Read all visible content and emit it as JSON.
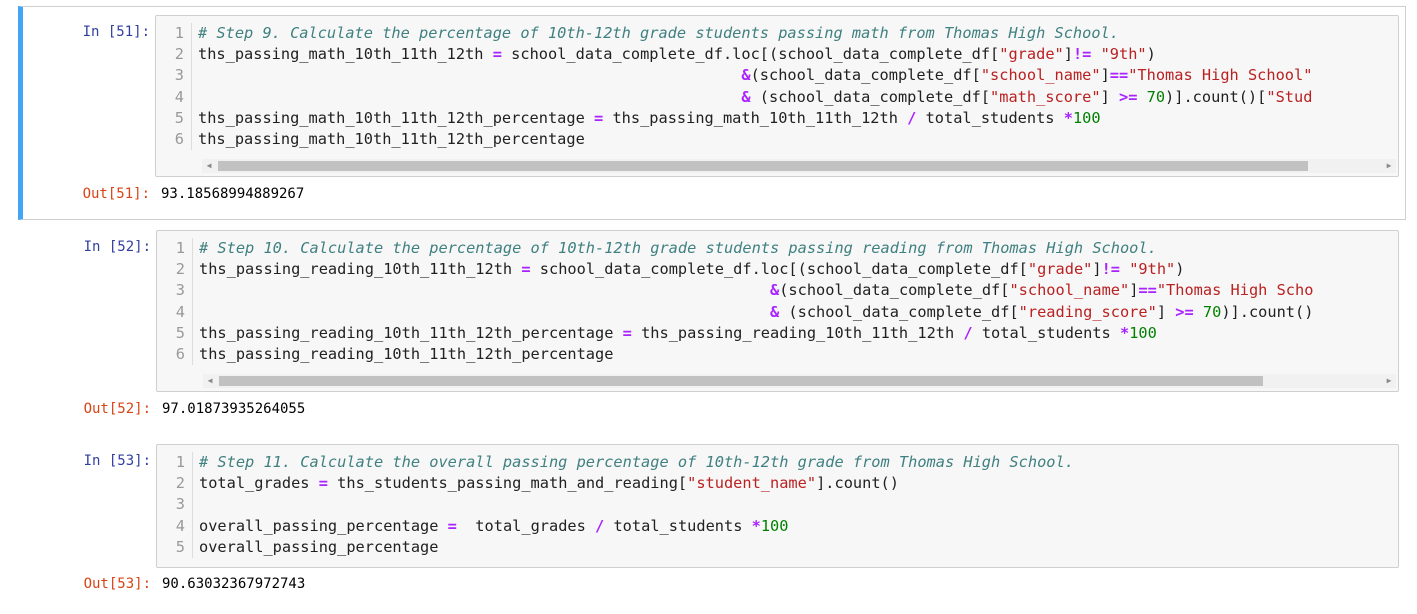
{
  "cells": [
    {
      "in_prompt": "In [51]:",
      "out_prompt": "Out[51]:",
      "output": "93.18568994889267",
      "lines": [
        {
          "n": "1",
          "tokens": [
            {
              "c": "cm-comment",
              "t": "# Step 9. Calculate the percentage of 10th-12th grade students passing math from Thomas High School."
            }
          ]
        },
        {
          "n": "2",
          "tokens": [
            {
              "c": "",
              "t": "ths_passing_math_10th_11th_12th "
            },
            {
              "c": "cm-op",
              "t": "="
            },
            {
              "c": "",
              "t": " school_data_complete_df.loc[(school_data_complete_df["
            },
            {
              "c": "cm-string",
              "t": "\"grade\""
            },
            {
              "c": "",
              "t": "]"
            },
            {
              "c": "cm-op",
              "t": "!="
            },
            {
              "c": "",
              "t": " "
            },
            {
              "c": "cm-string",
              "t": "\"9th\""
            },
            {
              "c": "",
              "t": ")"
            }
          ]
        },
        {
          "n": "3",
          "tokens": [
            {
              "c": "",
              "t": "                                                           "
            },
            {
              "c": "cm-op",
              "t": "&"
            },
            {
              "c": "",
              "t": "(school_data_complete_df["
            },
            {
              "c": "cm-string",
              "t": "\"school_name\""
            },
            {
              "c": "",
              "t": "]"
            },
            {
              "c": "cm-op",
              "t": "=="
            },
            {
              "c": "cm-string",
              "t": "\"Thomas High School\""
            }
          ]
        },
        {
          "n": "4",
          "tokens": [
            {
              "c": "",
              "t": "                                                           "
            },
            {
              "c": "cm-op",
              "t": "&"
            },
            {
              "c": "",
              "t": " (school_data_complete_df["
            },
            {
              "c": "cm-string",
              "t": "\"math_score\""
            },
            {
              "c": "",
              "t": "] "
            },
            {
              "c": "cm-op",
              "t": ">="
            },
            {
              "c": "",
              "t": " "
            },
            {
              "c": "cm-number",
              "t": "70"
            },
            {
              "c": "",
              "t": ")].count()["
            },
            {
              "c": "cm-string",
              "t": "\"Stud"
            }
          ]
        },
        {
          "n": "5",
          "tokens": [
            {
              "c": "",
              "t": "ths_passing_math_10th_11th_12th_percentage "
            },
            {
              "c": "cm-op",
              "t": "="
            },
            {
              "c": "",
              "t": " ths_passing_math_10th_11th_12th "
            },
            {
              "c": "cm-op",
              "t": "/"
            },
            {
              "c": "",
              "t": " total_students "
            },
            {
              "c": "cm-op",
              "t": "*"
            },
            {
              "c": "cm-number",
              "t": "100"
            }
          ]
        },
        {
          "n": "6",
          "tokens": [
            {
              "c": "",
              "t": "ths_passing_math_10th_11th_12th_percentage"
            }
          ]
        }
      ]
    },
    {
      "in_prompt": "In [52]:",
      "out_prompt": "Out[52]:",
      "output": "97.01873935264055",
      "lines": [
        {
          "n": "1",
          "tokens": [
            {
              "c": "cm-comment",
              "t": "# Step 10. Calculate the percentage of 10th-12th grade students passing reading from Thomas High School."
            }
          ]
        },
        {
          "n": "2",
          "tokens": [
            {
              "c": "",
              "t": "ths_passing_reading_10th_11th_12th "
            },
            {
              "c": "cm-op",
              "t": "="
            },
            {
              "c": "",
              "t": " school_data_complete_df.loc[(school_data_complete_df["
            },
            {
              "c": "cm-string",
              "t": "\"grade\""
            },
            {
              "c": "",
              "t": "]"
            },
            {
              "c": "cm-op",
              "t": "!="
            },
            {
              "c": "",
              "t": " "
            },
            {
              "c": "cm-string",
              "t": "\"9th\""
            },
            {
              "c": "",
              "t": ")"
            }
          ]
        },
        {
          "n": "3",
          "tokens": [
            {
              "c": "",
              "t": "                                                              "
            },
            {
              "c": "cm-op",
              "t": "&"
            },
            {
              "c": "",
              "t": "(school_data_complete_df["
            },
            {
              "c": "cm-string",
              "t": "\"school_name\""
            },
            {
              "c": "",
              "t": "]"
            },
            {
              "c": "cm-op",
              "t": "=="
            },
            {
              "c": "cm-string",
              "t": "\"Thomas High Scho"
            }
          ]
        },
        {
          "n": "4",
          "tokens": [
            {
              "c": "",
              "t": "                                                              "
            },
            {
              "c": "cm-op",
              "t": "&"
            },
            {
              "c": "",
              "t": " (school_data_complete_df["
            },
            {
              "c": "cm-string",
              "t": "\"reading_score\""
            },
            {
              "c": "",
              "t": "] "
            },
            {
              "c": "cm-op",
              "t": ">="
            },
            {
              "c": "",
              "t": " "
            },
            {
              "c": "cm-number",
              "t": "70"
            },
            {
              "c": "",
              "t": ")].count()"
            }
          ]
        },
        {
          "n": "5",
          "tokens": [
            {
              "c": "",
              "t": "ths_passing_reading_10th_11th_12th_percentage "
            },
            {
              "c": "cm-op",
              "t": "="
            },
            {
              "c": "",
              "t": " ths_passing_reading_10th_11th_12th "
            },
            {
              "c": "cm-op",
              "t": "/"
            },
            {
              "c": "",
              "t": " total_students "
            },
            {
              "c": "cm-op",
              "t": "*"
            },
            {
              "c": "cm-number",
              "t": "100"
            }
          ]
        },
        {
          "n": "6",
          "tokens": [
            {
              "c": "",
              "t": "ths_passing_reading_10th_11th_12th_percentage"
            }
          ]
        }
      ]
    },
    {
      "in_prompt": "In [53]:",
      "out_prompt": "Out[53]:",
      "output": "90.63032367972743",
      "lines": [
        {
          "n": "1",
          "tokens": [
            {
              "c": "cm-comment",
              "t": "# Step 11. Calculate the overall passing percentage of 10th-12th grade from Thomas High School."
            }
          ]
        },
        {
          "n": "2",
          "tokens": [
            {
              "c": "",
              "t": "total_grades "
            },
            {
              "c": "cm-op",
              "t": "="
            },
            {
              "c": "",
              "t": " ths_students_passing_math_and_reading["
            },
            {
              "c": "cm-string",
              "t": "\"student_name\""
            },
            {
              "c": "",
              "t": "].count()"
            }
          ]
        },
        {
          "n": "3",
          "tokens": []
        },
        {
          "n": "4",
          "tokens": [
            {
              "c": "",
              "t": "overall_passing_percentage "
            },
            {
              "c": "cm-op",
              "t": "="
            },
            {
              "c": "",
              "t": "  total_grades "
            },
            {
              "c": "cm-op",
              "t": "/"
            },
            {
              "c": "",
              "t": " total_students "
            },
            {
              "c": "cm-op",
              "t": "*"
            },
            {
              "c": "cm-number",
              "t": "100"
            }
          ]
        },
        {
          "n": "5",
          "tokens": [
            {
              "c": "",
              "t": "overall_passing_percentage"
            }
          ]
        }
      ]
    }
  ],
  "colors": {
    "selected_border": "#42a5f5",
    "in_prompt": "#303f9f",
    "out_prompt": "#d84315",
    "comment": "#408080",
    "string": "#ba2121",
    "operator": "#aa22ff",
    "number": "#008000",
    "editor_background": "#f7f7f7"
  },
  "icons": {
    "scroll_left": "◀",
    "scroll_right": "▶"
  }
}
